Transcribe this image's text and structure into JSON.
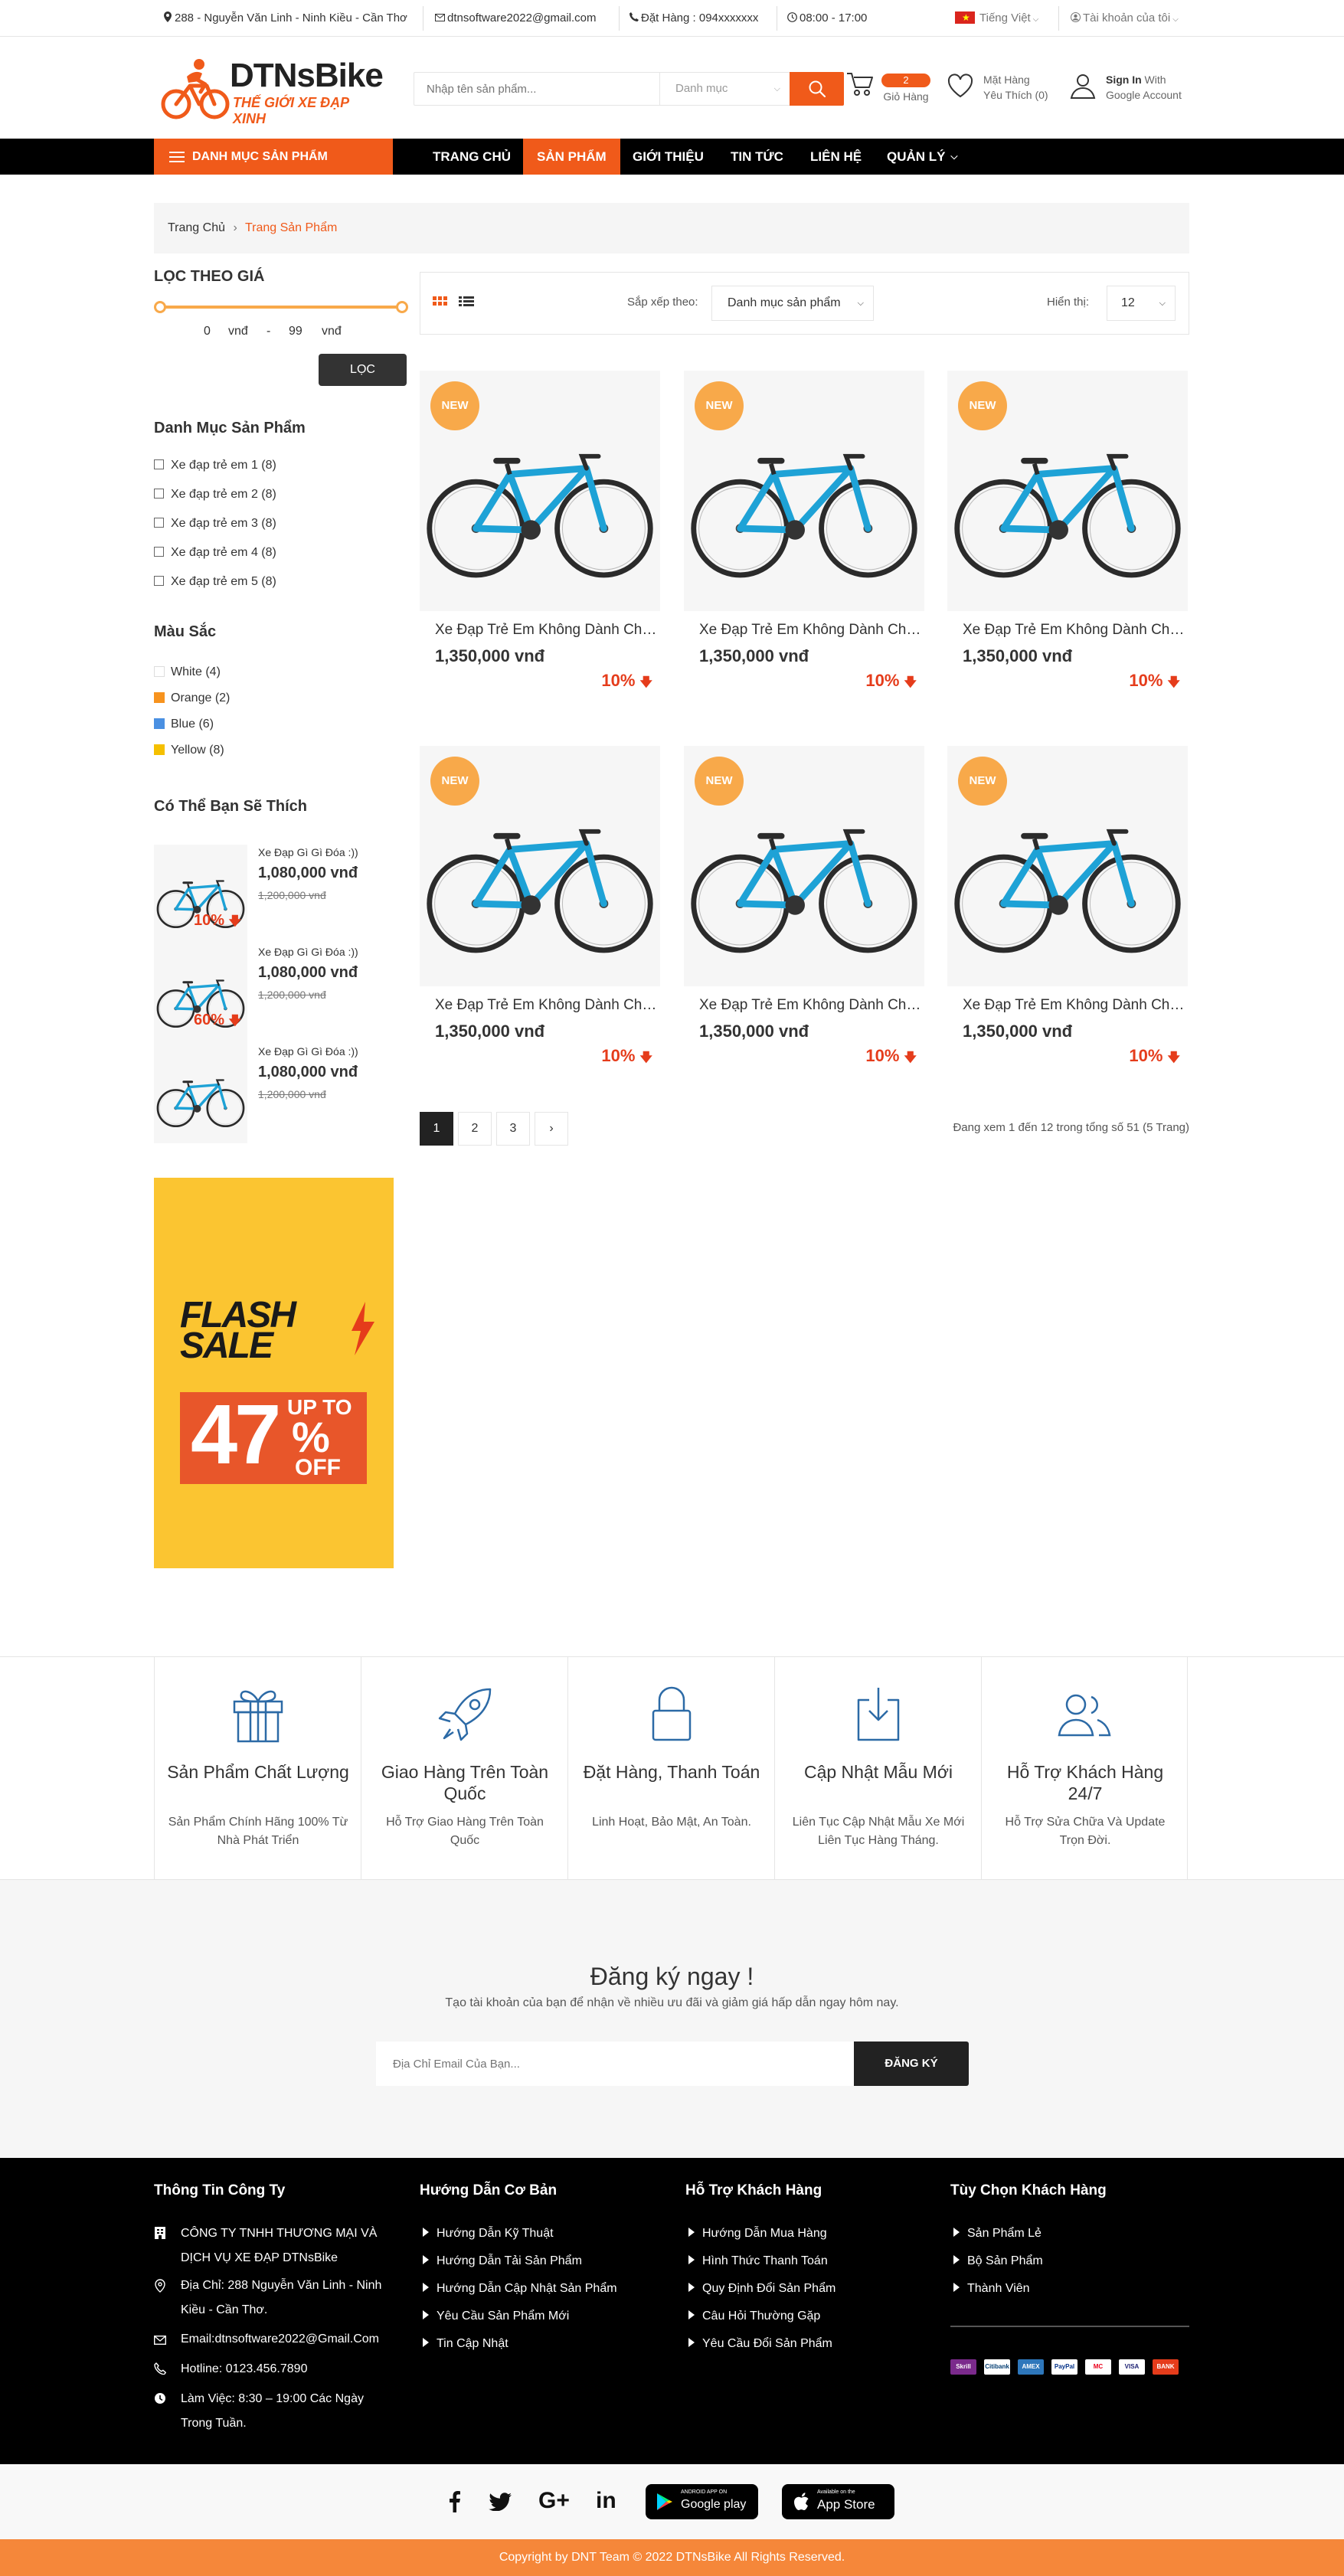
{
  "topbar": {
    "address": "288 - Nguyễn Văn Linh - Ninh Kiều - Cần Thơ",
    "email": "dtnsoftware2022@gmail.com",
    "phone": "Đặt Hàng : 094xxxxxxx",
    "hours": "08:00 - 17:00",
    "language": "Tiếng Việt",
    "account": "Tài khoản của tôi"
  },
  "header": {
    "logo_title": "DTNsBike",
    "logo_subtitle": "THẾ GIỚI XE ĐẠP XINH",
    "search_placeholder": "Nhập tên sản phẩm...",
    "search_category": "Danh mục",
    "cart_count": "2",
    "cart_label": "Giỏ Hàng",
    "wishlist_line1": "Mặt Hàng",
    "wishlist_line2": "Yêu Thích (0)",
    "signin_bold": "Sign In",
    "signin_rest": " With",
    "signin_line2": "Google Account"
  },
  "nav": {
    "category_button": "DANH MỤC SẢN PHẨM",
    "items": [
      "TRANG CHỦ",
      "SẢN PHẨM",
      "GIỚI THIỆU",
      "TIN TỨC",
      "LIÊN HỆ",
      "QUẢN LÝ"
    ],
    "active_index": 1
  },
  "breadcrumb": {
    "home": "Trang Chủ",
    "current": "Trang Sản Phẩm"
  },
  "sidebar": {
    "price_filter_title": "LỌC THEO GIÁ",
    "price_min": "0",
    "price_max": "99",
    "currency": "vnđ",
    "dash": "-",
    "filter_button": "LỌC",
    "category_title": "Danh Mục Sản Phẩm",
    "categories": [
      "Xe đạp trẻ em 1 (8)",
      "Xe đạp trẻ em 2 (8)",
      "Xe đạp trẻ em 3 (8)",
      "Xe đạp trẻ em 4 (8)",
      "Xe đạp trẻ em 5 (8)"
    ],
    "color_title": "Màu Sắc",
    "colors": [
      {
        "label": "White (4)",
        "color": "#ffffff"
      },
      {
        "label": "Orange (2)",
        "color": "#f7931e"
      },
      {
        "label": "Blue (6)",
        "color": "#4a90e2"
      },
      {
        "label": "Yellow (8)",
        "color": "#f5c000"
      }
    ],
    "suggest_title": "Có Thể Bạn Sẽ Thích",
    "suggestions": [
      {
        "name": "Xe Đạp Gì Gì Đóa :))",
        "price": "1,080,000 vnđ",
        "old_price": "1,200,000 vnđ",
        "discount": "10%"
      },
      {
        "name": "Xe Đạp Gì Gì Đóa :))",
        "price": "1,080,000 vnđ",
        "old_price": "1,200,000 vnđ",
        "discount": "60%"
      },
      {
        "name": "Xe Đạp Gì Gì Đóa :))",
        "price": "1,080,000 vnđ",
        "old_price": "1,200,000 vnđ",
        "discount": ""
      }
    ],
    "banner_line1": "FLASH",
    "banner_line2": "SALE",
    "banner_upto": "UP TO",
    "banner_percent": "47",
    "banner_pct_sign": "%",
    "banner_off": "OFF"
  },
  "toolbar": {
    "sort_label": "Sắp xếp theo:",
    "sort_value": "Danh mục sản phẩm",
    "show_label": "Hiển thị:",
    "show_value": "12"
  },
  "products": [
    {
      "badge": "NEW",
      "name": "Xe Đạp Trẻ Em Không Dành Cho Người Lớn",
      "price": "1,350,000 vnđ",
      "discount": "10%"
    },
    {
      "badge": "NEW",
      "name": "Xe Đạp Trẻ Em Không Dành Cho Người Lớn",
      "price": "1,350,000 vnđ",
      "discount": "10%"
    },
    {
      "badge": "NEW",
      "name": "Xe Đạp Trẻ Em Không Dành Cho Người Lớn",
      "price": "1,350,000 vnđ",
      "discount": "10%"
    },
    {
      "badge": "NEW",
      "name": "Xe Đạp Trẻ Em Không Dành Cho Người Lớn",
      "price": "1,350,000 vnđ",
      "discount": "10%"
    },
    {
      "badge": "NEW",
      "name": "Xe Đạp Trẻ Em Không Dành Cho Người Lớn",
      "price": "1,350,000 vnđ",
      "discount": "10%"
    },
    {
      "badge": "NEW",
      "name": "Xe Đạp Trẻ Em Không Dành Cho Người Lớn",
      "price": "1,350,000 vnđ",
      "discount": "10%"
    }
  ],
  "pagination": {
    "pages": [
      "1",
      "2",
      "3"
    ],
    "next": "›",
    "summary": "Đang xem 1 đến 12 trong tổng số 51 (5 Trang)"
  },
  "features": [
    {
      "icon": "gift-icon",
      "title": "Sản Phẩm Chất Lượng",
      "desc": "Sản Phẩm Chính Hãng 100% Từ Nhà Phát Triển"
    },
    {
      "icon": "rocket-icon",
      "title": "Giao Hàng Trên Toàn Quốc",
      "desc": "Hỗ Trợ Giao Hàng Trên Toàn Quốc"
    },
    {
      "icon": "lock-icon",
      "title": "Đặt Hàng, Thanh Toán",
      "desc": "Linh Hoạt, Bảo Mật, An Toàn."
    },
    {
      "icon": "download-icon",
      "title": "Cập Nhật Mẫu Mới",
      "desc": "Liên Tục Cập Nhật Mẫu Xe Mới Liên Tục Hàng Tháng."
    },
    {
      "icon": "users-icon",
      "title": "Hỗ Trợ Khách Hàng 24/7",
      "desc": "Hỗ Trợ Sửa Chữa Và Update Trọn Đời."
    }
  ],
  "newsletter": {
    "title": "Đăng ký ngay !",
    "subtitle": "Tạo tài khoản của bạn để nhận về nhiều ưu đãi và giảm giá hấp dẫn ngay hôm nay.",
    "placeholder": "Địa Chỉ Email Của Bạn...",
    "button": "ĐĂNG KÝ"
  },
  "footer": {
    "col1_title": "Thông Tin Công Ty",
    "company_line1": "CÔNG TY TNHH THƯƠNG MẠI VÀ",
    "company_line2": "DỊCH VỤ XE ĐẠP DTNsBike",
    "address_line1": "Địa Chỉ: 288 Nguyễn Văn Linh - Ninh",
    "address_line2": "Kiều - Cần Thơ.",
    "email": "Email:dtnsoftware2022@Gmail.Com",
    "hotline": "Hotline: 0123.456.7890",
    "hours_line1": "Làm Việc: 8:30 – 19:00 Các Ngày",
    "hours_line2": "Trong Tuần.",
    "col2_title": "Hướng Dẫn Cơ Bản",
    "col2_links": [
      "Hướng Dẫn Kỹ Thuật",
      "Hướng Dẫn Tải Sản Phẩm",
      "Hướng Dẫn Cập Nhật Sản Phẩm",
      "Yêu Cầu Sản Phẩm Mới",
      "Tin Cập Nhật"
    ],
    "col3_title": "Hỗ Trợ Khách Hàng",
    "col3_links": [
      "Hướng Dẫn Mua Hàng",
      "Hình Thức Thanh Toán",
      "Quy Định Đổi Sản Phẩm",
      "Câu Hỏi Thường Gặp",
      "Yêu Cầu Đổi Sản Phẩm"
    ],
    "col4_title": "Tùy Chọn Khách Hàng",
    "col4_links": [
      "Sản Phẩm Lẻ",
      "Bộ Sản Phẩm",
      "Thành Viên"
    ],
    "payments": [
      "Skrill",
      "Citibank",
      "AMEX",
      "PayPal",
      "MC",
      "VISA",
      "BANK"
    ]
  },
  "social": {
    "google_play_small": "ANDROID APP ON",
    "google_play": "Google play",
    "app_store_small": "Available on the",
    "app_store": "App Store"
  },
  "copyright": "Copyright by DNT Team © 2022 DTNsBike All Rights Reserved."
}
